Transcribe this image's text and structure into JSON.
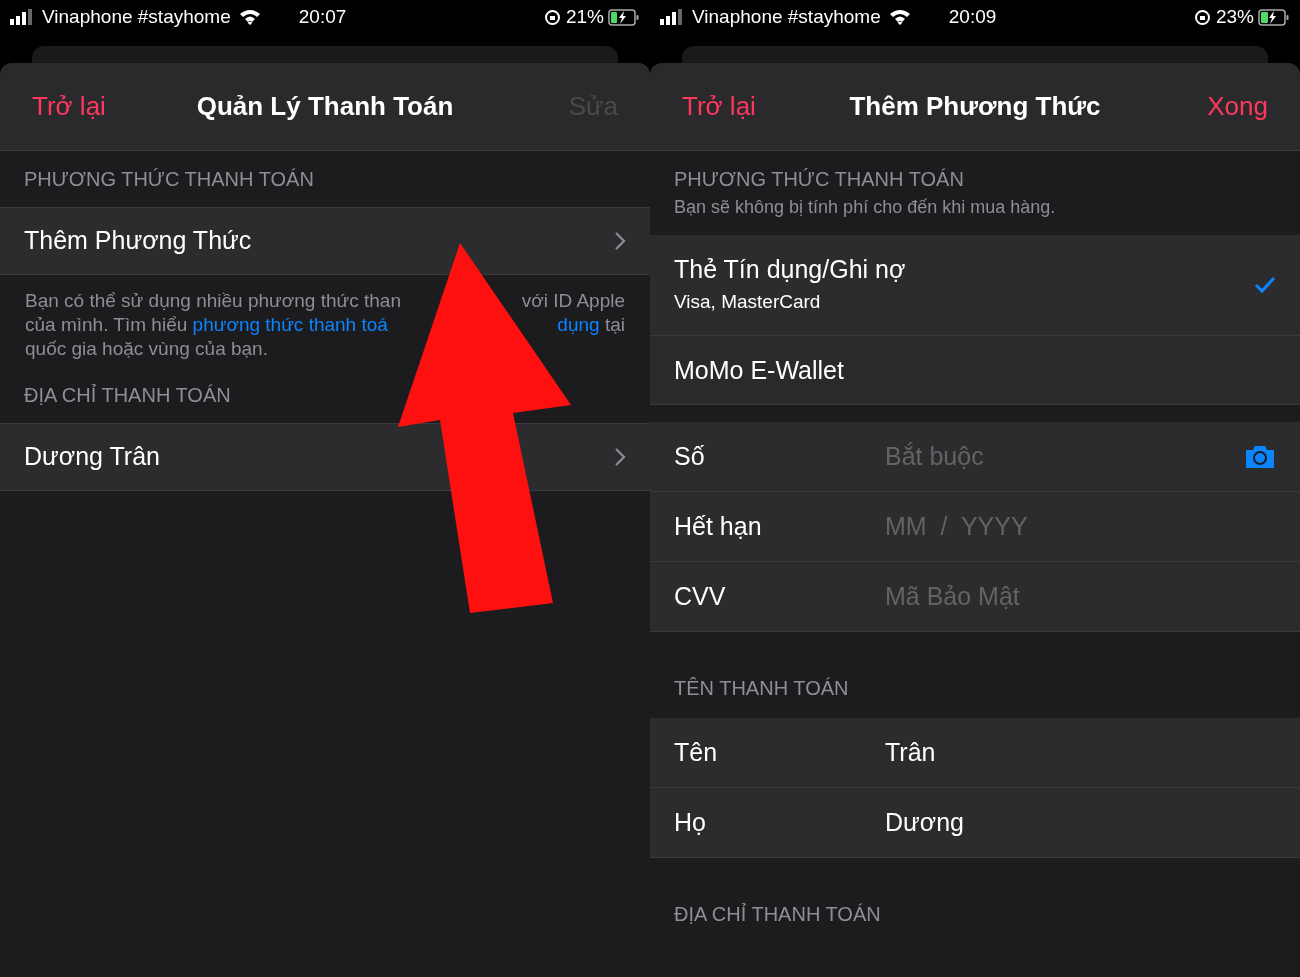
{
  "panels": [
    {
      "status_bar": {
        "carrier": "Vinaphone #stayhome",
        "time": "20:07",
        "battery": "21%"
      },
      "nav": {
        "back": "Trở lại",
        "title": "Quản Lý Thanh Toán",
        "action": "Sửa",
        "action_disabled": true
      },
      "items": [
        {
          "kind": "header",
          "text": "PHƯƠNG THỨC THANH TOÁN"
        },
        {
          "kind": "nav_row",
          "label": "Thêm Phương Thức"
        },
        {
          "kind": "footer",
          "lines": [
            {
              "left": [
                {
                  "text": "Bạn có thể sử dụng nhiều phương thức than",
                  "link": false
                }
              ],
              "right": [
                {
                  "text": "với ID Apple",
                  "link": false
                }
              ]
            },
            {
              "left": [
                {
                  "text": "của mình. Tìm hiểu ",
                  "link": false
                },
                {
                  "text": "phương thức thanh toá",
                  "link": true
                }
              ],
              "right": [
                {
                  "text": "dụng",
                  "link": true
                },
                {
                  "text": " tại",
                  "link": false
                }
              ]
            },
            {
              "left": [
                {
                  "text": "quốc gia hoặc vùng của bạn.",
                  "link": false
                }
              ]
            }
          ]
        },
        {
          "kind": "header",
          "text": "ĐỊA CHỈ THANH TOÁN"
        },
        {
          "kind": "nav_row",
          "label": "Dương Trân"
        }
      ],
      "arrow": true
    },
    {
      "status_bar": {
        "carrier": "Vinaphone #stayhome",
        "time": "20:09",
        "battery": "23%"
      },
      "nav": {
        "back": "Trở lại",
        "title": "Thêm Phương Thức",
        "action": "Xong",
        "action_disabled": false
      },
      "items": [
        {
          "kind": "header",
          "text": "PHƯƠNG THỨC THANH TOÁN",
          "subtext": "Bạn sẽ không bị tính phí cho đến khi mua hàng."
        },
        {
          "kind": "choice",
          "title": "Thẻ Tín dụng/Ghi nợ",
          "subtitle": "Visa, MasterCard",
          "selected": true
        },
        {
          "kind": "choice",
          "title": "MoMo E-Wallet",
          "selected": false
        },
        {
          "kind": "gap"
        },
        {
          "kind": "field",
          "label": "Số",
          "placeholder": "Bắt buộc",
          "camera": true
        },
        {
          "kind": "field",
          "label": "Hết hạn",
          "placeholder": "MM  /  YYYY"
        },
        {
          "kind": "field",
          "label": "CVV",
          "placeholder": "Mã Bảo Mật"
        },
        {
          "kind": "header",
          "text": "TÊN THANH TOÁN",
          "tall": true
        },
        {
          "kind": "field",
          "label": "Tên",
          "value": "Trân"
        },
        {
          "kind": "field",
          "label": "Họ",
          "value": "Dương"
        },
        {
          "kind": "header",
          "text": "ĐỊA CHỈ THANH TOÁN",
          "tall": true
        }
      ]
    }
  ]
}
